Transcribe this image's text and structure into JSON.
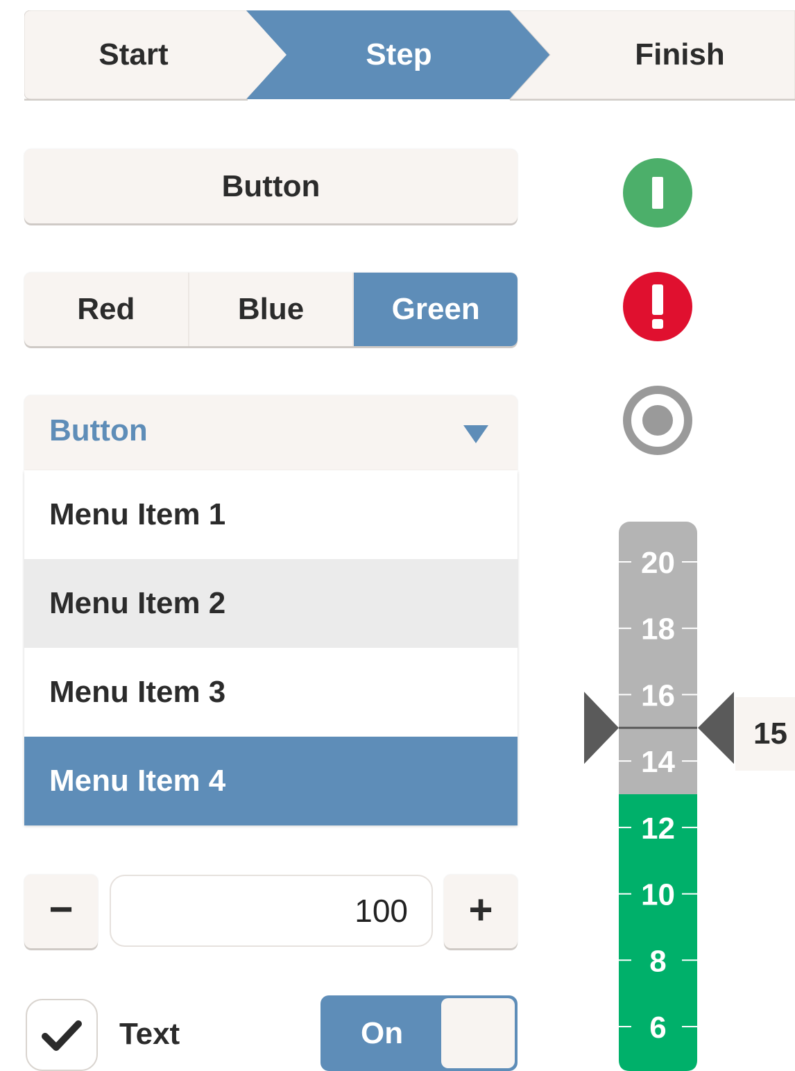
{
  "stepper": {
    "steps": [
      "Start",
      "Step",
      "Finish"
    ],
    "active_index": 1
  },
  "button": {
    "label": "Button"
  },
  "segmented": {
    "options": [
      "Red",
      "Blue",
      "Green"
    ],
    "selected": "Green"
  },
  "dropdown": {
    "label": "Button",
    "items": [
      "Menu Item 1",
      "Menu Item 2",
      "Menu Item 3",
      "Menu Item 4"
    ],
    "hovered_index": 1,
    "selected_index": 3
  },
  "numeric": {
    "value": "100",
    "minus": "−",
    "plus": "+"
  },
  "checkbox": {
    "checked": true,
    "label": "Text"
  },
  "toggle": {
    "label": "On",
    "state": true
  },
  "status_icons": [
    {
      "name": "info-icon",
      "color": "#4caf6a"
    },
    {
      "name": "alert-icon",
      "color": "#e0102f"
    },
    {
      "name": "radio-icon",
      "color": "#9a9a9a"
    }
  ],
  "gauge": {
    "ticks": [
      "20",
      "18",
      "16",
      "14",
      "12",
      "10",
      "8",
      "6"
    ],
    "value": "15",
    "range": [
      6,
      20
    ],
    "green_max": 13,
    "colors": {
      "track": "#b4b4b4",
      "green": "#00b06a",
      "pointer": "#5a5a5a"
    }
  },
  "colors": {
    "accent": "#5e8db8",
    "surface": "#f8f4f1"
  }
}
